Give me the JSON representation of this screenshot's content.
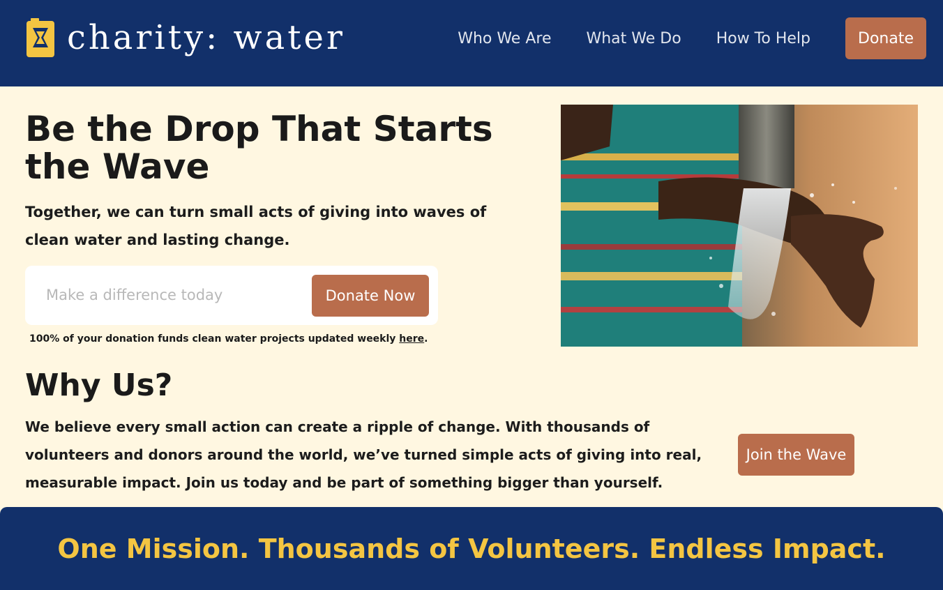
{
  "brand": {
    "name": "charity: water",
    "logo_icon": "jerry-can-icon",
    "logo_color": "#f4c542"
  },
  "nav": {
    "items": [
      "Who We Are",
      "What We Do",
      "How To Help"
    ],
    "donate_label": "Donate"
  },
  "hero": {
    "title": "Be the Drop That Starts the Wave",
    "subtitle": "Together, we can turn small acts of giving into waves of clean water and lasting change.",
    "input_placeholder": "Make a difference today",
    "donate_button": "Donate Now",
    "note_text": "100% of your donation funds clean water projects updated weekly ",
    "note_link": "here",
    "note_end": "."
  },
  "why": {
    "title": "Why Us?",
    "body": "We believe every small action can create a ripple of change. With thousands of volunteers and donors around the world, we’ve turned simple acts of giving into real, measurable impact. Join us today and be part of something bigger than yourself.",
    "button": "Join the Wave"
  },
  "banner": {
    "text": "One Mission. Thousands of Volunteers. Endless Impact."
  },
  "colors": {
    "navy": "#12306a",
    "accent": "#b96d4c",
    "cream": "#fff7e1",
    "yellow": "#f4c542"
  }
}
